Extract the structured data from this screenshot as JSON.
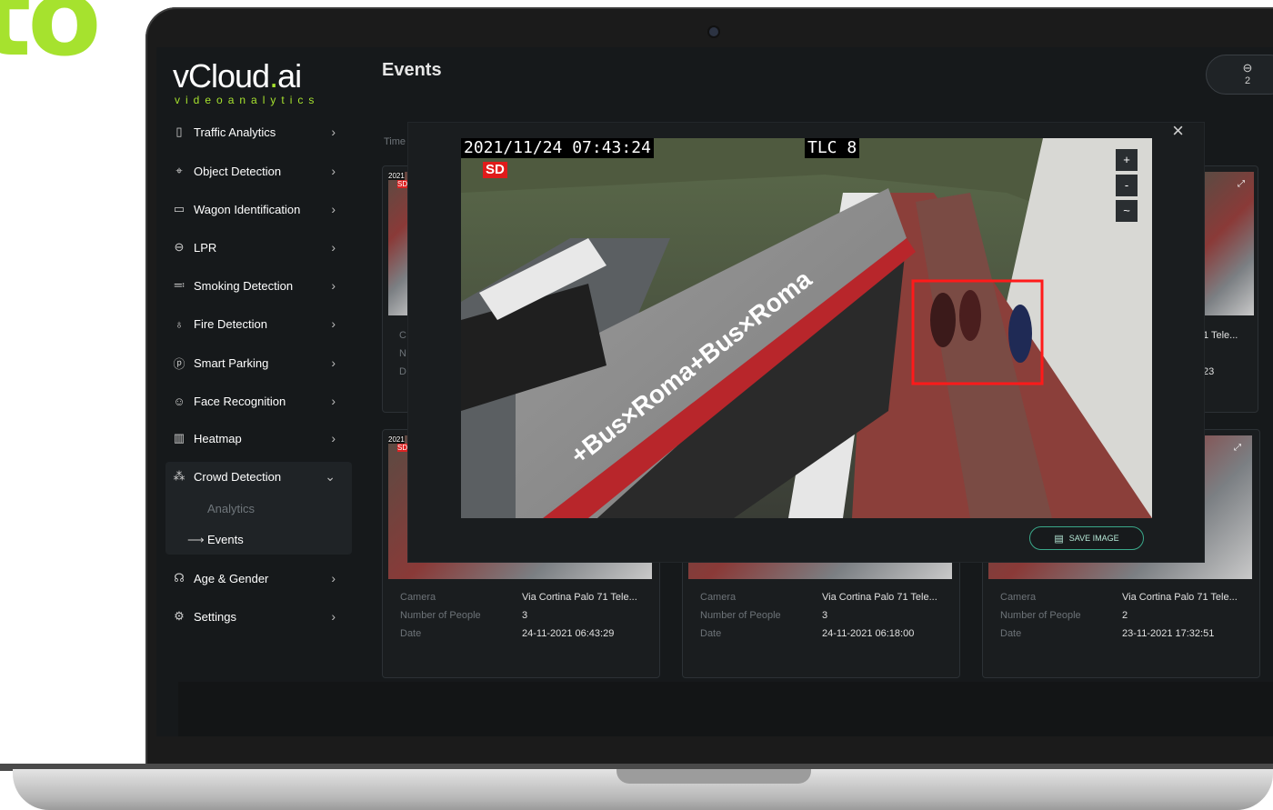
{
  "brand_fragment": "to",
  "logo": {
    "main_before_dot": "vCloud",
    "main_dot": ".",
    "main_after_dot": "ai",
    "subtitle": "videoanalytics"
  },
  "page_title": "Events",
  "car_badge": {
    "count": "2",
    "icon": "car-icon"
  },
  "time_label": "Time",
  "nav": [
    {
      "label": "Traffic Analytics",
      "icon": "traffic-light-icon"
    },
    {
      "label": "Object Detection",
      "icon": "crosshair-icon"
    },
    {
      "label": "Wagon Identification",
      "icon": "wagon-icon"
    },
    {
      "label": "LPR",
      "icon": "car-icon"
    },
    {
      "label": "Smoking Detection",
      "icon": "cigarette-icon"
    },
    {
      "label": "Fire Detection",
      "icon": "flame-icon"
    },
    {
      "label": "Smart Parking",
      "icon": "parking-icon"
    },
    {
      "label": "Face Recognition",
      "icon": "face-scan-icon"
    },
    {
      "label": "Heatmap",
      "icon": "map-icon"
    },
    {
      "label": "Crowd Detection",
      "icon": "crowd-icon",
      "expanded": true,
      "children": [
        {
          "label": "Analytics",
          "active": false
        },
        {
          "label": "Events",
          "active": true
        }
      ]
    },
    {
      "label": "Age & Gender",
      "icon": "people-icon"
    },
    {
      "label": "Settings",
      "icon": "gear-icon"
    }
  ],
  "field_labels": {
    "camera": "Camera",
    "people": "Number of People",
    "date": "Date"
  },
  "cards": [
    {
      "camera": "Via Cortina Palo 71 Tele...",
      "people": "3",
      "date": "24-11-2021 06:43:29"
    },
    {
      "camera": "Via Cortina Palo 71 Tele...",
      "people": "3",
      "date": "24-11-2021 06:18:00"
    },
    {
      "camera": "Via Cortina Palo 71 Tele...",
      "people": "2",
      "date": "23-11-2021 17:32:51"
    }
  ],
  "partial_cards": {
    "top_left_stamp": "2021",
    "top_left_sd": "SD",
    "top_left_field_initials": [
      "C",
      "N",
      "D"
    ],
    "bottom_left_stamp": "2021",
    "bottom_left_sd": "SD",
    "top_right_camera": "1 Tele...",
    "top_right_date_fragment": "23"
  },
  "modal": {
    "timestamp": "2021/11/24 07:43:24",
    "camera_tag": "TLC 8",
    "sd_badge": "SD",
    "zoom_in": "+",
    "zoom_out": "-",
    "zoom_reset": "~",
    "save_label": "SAVE IMAGE",
    "close_label": "×"
  },
  "bus_text": "+Bus×Roma+Bus×Roma",
  "colors": {
    "accent_green": "#a6e22e",
    "save_border": "#3aa88a",
    "detection_box": "#ff1a1a",
    "bus_red": "#b8262b"
  }
}
